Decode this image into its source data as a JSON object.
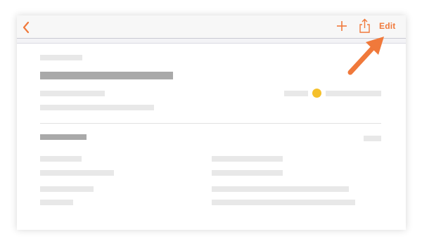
{
  "toolbar": {
    "edit_label": "Edit",
    "accent_color": "#f0793b",
    "icons": [
      "back-chevron-icon",
      "plus-icon",
      "share-icon"
    ]
  },
  "annotation": {
    "icon": "pointer-arrow-icon",
    "color": "#f0793b"
  },
  "status": {
    "indicator_color": "#f5c02b"
  }
}
